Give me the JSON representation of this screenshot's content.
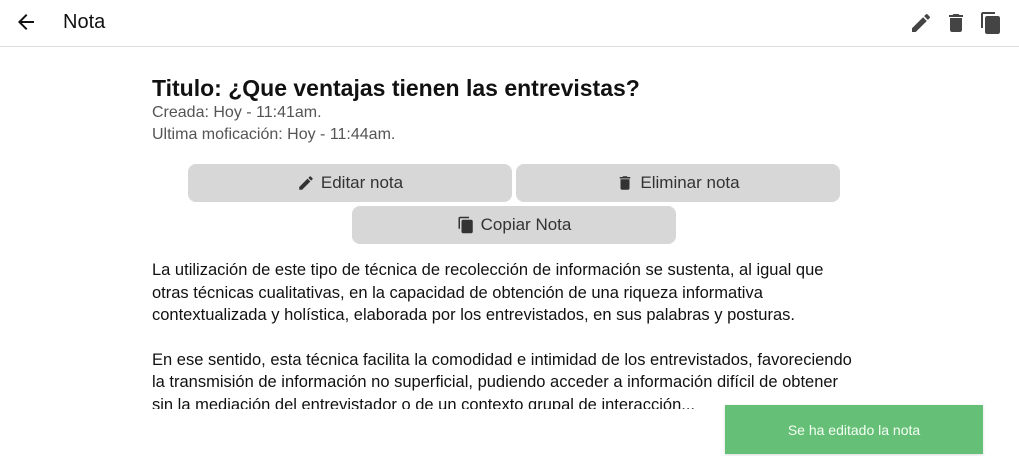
{
  "header": {
    "title": "Nota",
    "icons": [
      "arrow-left-icon",
      "pencil-icon",
      "trash-icon",
      "copy-icon"
    ]
  },
  "note": {
    "title": "Titulo: ¿Que ventajas tienen las entrevistas?",
    "created": "Creada: Hoy - 11:41am.",
    "modified": "Ultima moficación: Hoy - 11:44am.",
    "paragraphs": [
      "La utilización de este tipo de técnica de recolección de información se sustenta, al igual que otras técnicas cualitativas, en la capacidad de obtención de una riqueza informativa contextualizada y holística, elaborada por los entrevistados, en sus palabras y posturas.",
      "En ese sentido, esta técnica facilita la comodidad e intimidad de los entrevistados, favoreciendo la transmisión de información no superficial, pudiendo acceder a información difícil de obtener sin la mediación del entrevistador o de un contexto grupal de interacción..."
    ]
  },
  "buttons": {
    "edit_label": "Editar nota",
    "delete_label": "Eliminar nota",
    "copy_label": "Copiar Nota"
  },
  "toast": {
    "message": "Se ha editado la nota",
    "color": "#66bf77"
  }
}
